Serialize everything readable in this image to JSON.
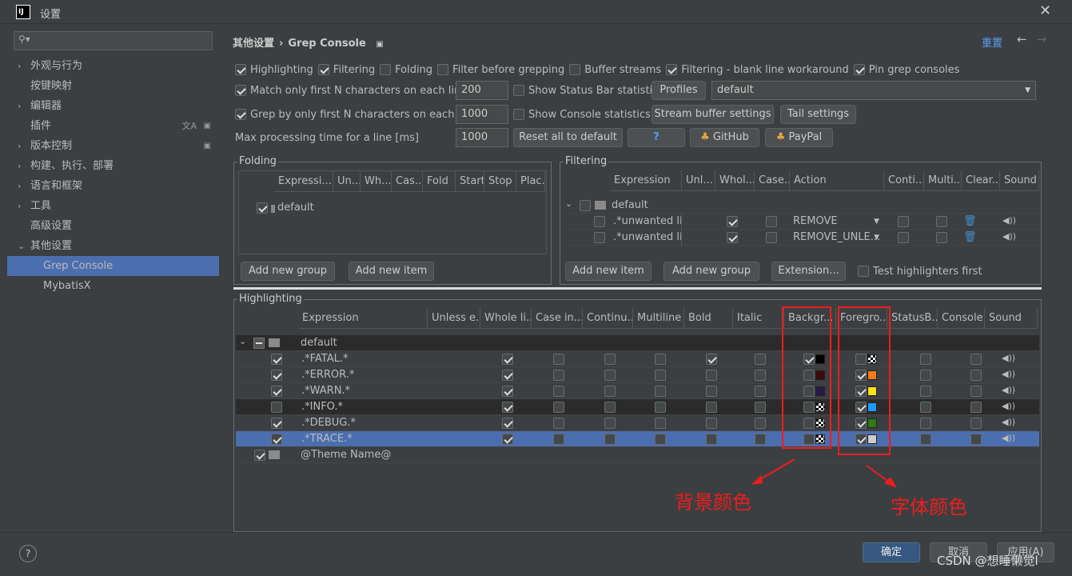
{
  "window": {
    "title": "设置"
  },
  "sidebar": {
    "search_placeholder": "",
    "items": [
      {
        "label": "外观与行为",
        "arrow": "›"
      },
      {
        "label": "按键映射",
        "arrow": ""
      },
      {
        "label": "编辑器",
        "arrow": "›"
      },
      {
        "label": "插件",
        "arrow": ""
      },
      {
        "label": "版本控制",
        "arrow": "›"
      },
      {
        "label": "构建、执行、部署",
        "arrow": "›"
      },
      {
        "label": "语言和框架",
        "arrow": "›"
      },
      {
        "label": "工具",
        "arrow": "›"
      },
      {
        "label": "高级设置",
        "arrow": ""
      },
      {
        "label": "其他设置",
        "arrow": "⌄"
      },
      {
        "label": "Grep Console",
        "arrow": ""
      },
      {
        "label": "MybatisX",
        "arrow": ""
      }
    ]
  },
  "header": {
    "crumb1": "其他设置",
    "crumb2": "Grep Console",
    "reset": "重置"
  },
  "options": {
    "highlighting": "Highlighting",
    "filtering": "Filtering",
    "folding": "Folding",
    "filter_before": "Filter before grepping",
    "buffer_streams": "Buffer streams",
    "filtering_blank": "Filtering - blank line workaround",
    "pin": "Pin grep consoles",
    "match_first": "Match only first N characters on each line",
    "match_value": "200",
    "show_status": "Show Status Bar statistics",
    "profiles": "Profiles",
    "profile_value": "default",
    "grep_first": "Grep by only first N characters on each line",
    "grep_value": "1000",
    "show_console": "Show Console statistics",
    "stream_buffer": "Stream buffer settings",
    "tail": "Tail settings",
    "max_time": "Max processing time for a line [ms]",
    "max_value": "1000",
    "reset_all": "Reset all to default",
    "help": "?",
    "github": "GitHub",
    "paypal": "PayPal"
  },
  "folding": {
    "title": "Folding",
    "columns": [
      "Expressi...",
      "Un...",
      "Wh...",
      "Cas...",
      "Fold",
      "Start",
      "Stop",
      "Plac..."
    ],
    "row": "default",
    "add_group": "Add new group",
    "add_item": "Add new item"
  },
  "filtering": {
    "title": "Filtering",
    "columns": [
      "Expression",
      "Unl...",
      "Whol...",
      "Case...",
      "Action",
      "Conti...",
      "Multi...",
      "Clear...",
      "Sound"
    ],
    "group": "default",
    "rows": [
      {
        "expr": ".*unwanted li...",
        "action": "REMOVE"
      },
      {
        "expr": ".*unwanted li...",
        "action": "REMOVE_UNLE..."
      }
    ],
    "add_item": "Add new item",
    "add_group": "Add new group",
    "extension": "Extension...",
    "test": "Test highlighters first"
  },
  "highlighting": {
    "title": "Highlighting",
    "columns": [
      "Expression",
      "Unless e...",
      "Whole li...",
      "Case in...",
      "Continu...",
      "Multiline",
      "Bold",
      "Italic",
      "Backgr...",
      "Foregro...",
      "StatusB...",
      "Console...",
      "Sound"
    ],
    "group": "default",
    "rows": [
      {
        "expr": ".*FATAL.*",
        "bg": "#000000",
        "fg": "checker"
      },
      {
        "expr": ".*ERROR.*",
        "bg": "#3a0c0c",
        "fg": "#f07b1e"
      },
      {
        "expr": ".*WARN.*",
        "bg": "#2a1a4a",
        "fg": "#ffe11a"
      },
      {
        "expr": ".*INFO.*",
        "bg": "checker",
        "fg": "#1e9bf5"
      },
      {
        "expr": ".*DEBUG.*",
        "bg": "checker",
        "fg": "#2e7d13"
      },
      {
        "expr": ".*TRACE.*",
        "bg": "checker",
        "fg": "#cccccc"
      }
    ],
    "theme": "@Theme Name@"
  },
  "annotations": {
    "bg": "背景颜色",
    "fg": "字体颜色"
  },
  "footer": {
    "ok": "确定",
    "cancel": "取消",
    "apply": "应用(A)",
    "watermark": "CSDN @想睡懒觉l"
  }
}
